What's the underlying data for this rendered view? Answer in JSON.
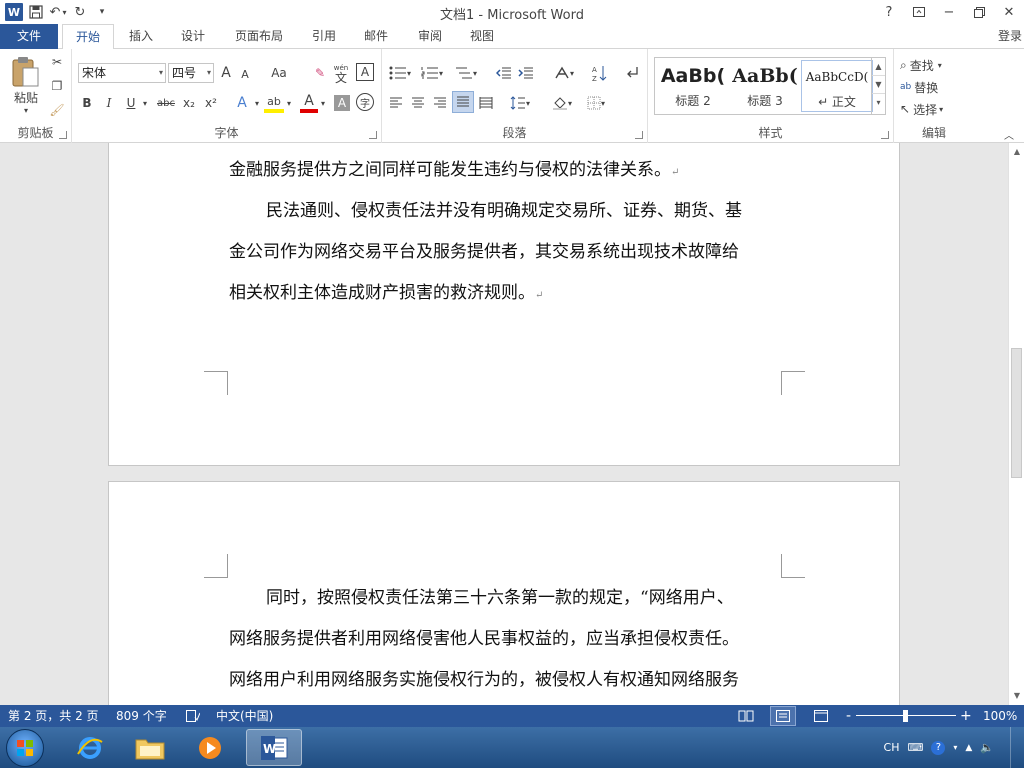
{
  "titlebar": {
    "title": "文档1 - Microsoft Word",
    "help": "?",
    "word_logo": "W"
  },
  "tabs": [
    "文件",
    "开始",
    "插入",
    "设计",
    "页面布局",
    "引用",
    "邮件",
    "审阅",
    "视图"
  ],
  "login": "登录",
  "ribbon": {
    "clipboard": {
      "label": "剪贴板",
      "paste": "粘贴"
    },
    "font": {
      "label": "字体",
      "font_name": "宋体",
      "font_size": "四号",
      "bold": "B",
      "italic": "I",
      "underline": "U",
      "strike": "abc",
      "sub": "x₂",
      "sup": "x²",
      "grow": "A",
      "shrink": "A",
      "case": "Aa",
      "phonetic_top": "wén",
      "phonetic_char": "文",
      "border_char": "A",
      "effects": "A",
      "highlight": "ab",
      "font_color": "A",
      "shading_char": "A",
      "enclose_char": "字"
    },
    "paragraph": {
      "label": "段落"
    },
    "styles": {
      "label": "样式",
      "items": [
        {
          "sample": "AaBb(",
          "name": "标题 2"
        },
        {
          "sample": "AaBb(",
          "name": "标题 3"
        },
        {
          "sample": "AaBbCcD(",
          "name": "↵ 正文"
        }
      ]
    },
    "editing": {
      "label": "编辑",
      "find": "查找",
      "replace": "替换",
      "select": "选择"
    }
  },
  "document": {
    "page1_lines": [
      "金融服务提供方之间同样可能发生违约与侵权的法律关系。",
      "民法通则、侵权责任法并没有明确规定交易所、证券、期货、基",
      "金公司作为网络交易平台及服务提供者，其交易系统出现技术故障给",
      "相关权利主体造成财产损害的救济规则。"
    ],
    "page2_lines": [
      "同时，按照侵权责任法第三十六条第一款的规定，“网络用户、",
      "网络服务提供者利用网络侵害他人民事权益的，应当承担侵权责任。",
      "网络用户利用网络服务实施侵权行为的，被侵权人有权通知网络服务"
    ],
    "para_mark": "↵"
  },
  "statusbar": {
    "page_info": "第 2 页，共 2 页",
    "word_count": "809 个字",
    "language": "中文(中国)",
    "zoom": "100%",
    "zoom_minus": "-",
    "zoom_plus": "+"
  },
  "taskbar": {
    "tray_lang": "CH"
  },
  "colors": {
    "word_blue": "#2b579a",
    "taskbar": "#2c5d93"
  }
}
